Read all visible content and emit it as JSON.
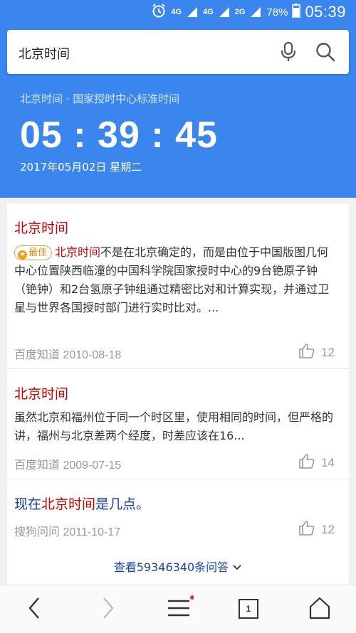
{
  "status_bar": {
    "network_1": "4G",
    "network_2": "4G",
    "network_3": "2G",
    "battery": "78%",
    "time": "05:39"
  },
  "search": {
    "query": "北京时间"
  },
  "hero": {
    "subtitle": "北京时间 · 国家授时中心标准时间",
    "time": "05 : 39 : 45",
    "date": "2017年05月02日  星期二"
  },
  "results": [
    {
      "title": "北京时间",
      "badge": "最佳",
      "highlight": "北京时间",
      "body": "不是在北京确定的，而是由位于中国版图几何中心位置陕西临潼的中国科学院国家授时中心的9台铯原子钟（铯钟）和2台氢原子钟组通过精密比对和计算实现，并通过卫星与世界各国授时部门进行实时比对。...",
      "source": "百度知道 2010-08-18",
      "likes": "12"
    },
    {
      "title": "北京时间",
      "body": "虽然北京和福州位于同一个时区里，使用相同的时间，但严格的讲，福州与北京差两个经度，时差应该在16...",
      "source": "百度知道 2009-07-15",
      "likes": "14"
    },
    {
      "title_prefix": "现在",
      "title_highlight": "北京时间",
      "title_suffix": "是几点。",
      "source": "搜狗问问 2011-10-17",
      "likes": "12"
    }
  ],
  "more_link": "查看59346340条问答",
  "bottom_nav": {
    "tab_count": "1"
  }
}
